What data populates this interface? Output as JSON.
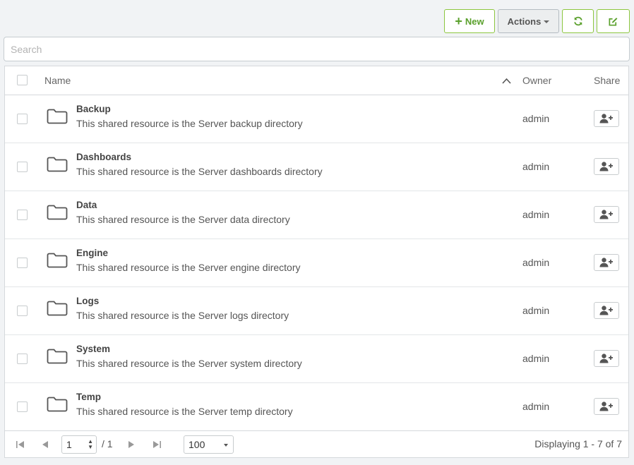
{
  "toolbar": {
    "new_label": "New",
    "actions_label": "Actions",
    "accent": "#5aa02c",
    "border": "#8cc63f"
  },
  "search": {
    "placeholder": "Search",
    "value": ""
  },
  "table": {
    "headers": {
      "name": "Name",
      "owner": "Owner",
      "share": "Share"
    },
    "sort_icon": "chevron-up-icon",
    "rows": [
      {
        "name": "Backup",
        "description": "This shared resource is the Server backup directory",
        "owner": "admin"
      },
      {
        "name": "Dashboards",
        "description": "This shared resource is the Server dashboards directory",
        "owner": "admin"
      },
      {
        "name": "Data",
        "description": "This shared resource is the Server data directory",
        "owner": "admin"
      },
      {
        "name": "Engine",
        "description": "This shared resource is the Server engine directory",
        "owner": "admin"
      },
      {
        "name": "Logs",
        "description": "This shared resource is the Server logs directory",
        "owner": "admin"
      },
      {
        "name": "System",
        "description": "This shared resource is the Server system directory",
        "owner": "admin"
      },
      {
        "name": "Temp",
        "description": "This shared resource is the Server temp directory",
        "owner": "admin"
      }
    ]
  },
  "pager": {
    "current_page": "1",
    "total_pages": "/ 1",
    "page_size": "100",
    "displaying": "Displaying 1 - 7 of 7"
  }
}
